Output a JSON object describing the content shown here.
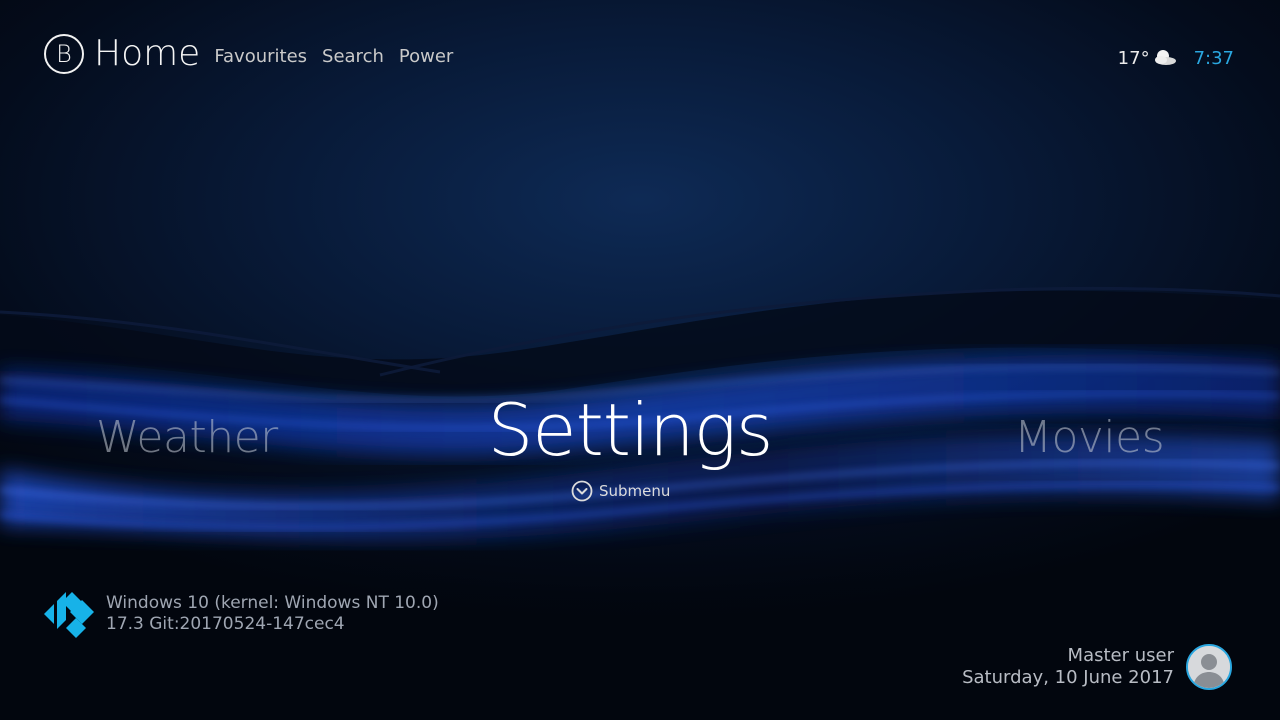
{
  "header": {
    "logo_letter": "B",
    "title": "Home",
    "links": [
      "Favourites",
      "Search",
      "Power"
    ]
  },
  "status": {
    "temperature": "17°",
    "weather_icon": "partly-cloudy-icon",
    "time": "7:37"
  },
  "menu": {
    "left": "Weather",
    "center": "Settings",
    "right": "Movies",
    "submenu_label": "Submenu"
  },
  "system": {
    "os": "Windows 10 (kernel: Windows NT 10.0)",
    "build": "17.3 Git:20170524-147cec4",
    "logo_icon": "kodi-logo-icon"
  },
  "user": {
    "name": "Master user",
    "date": "Saturday, 10 June 2017",
    "avatar_icon": "user-avatar-icon"
  },
  "colors": {
    "accent": "#2aa7e0",
    "background": "#040c1c",
    "wave_blue": "#1e4fd8"
  }
}
